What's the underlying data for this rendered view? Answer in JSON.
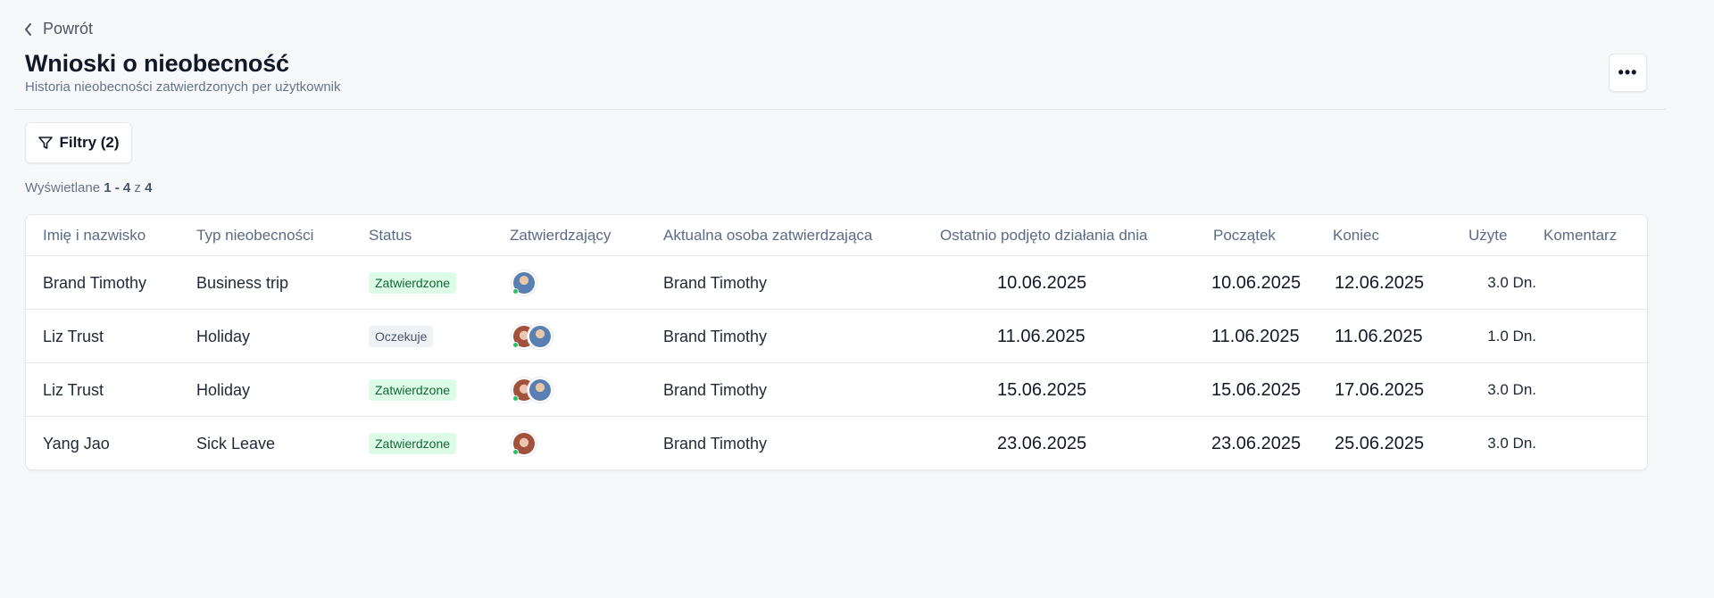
{
  "nav": {
    "back_label": "Powrót"
  },
  "header": {
    "title": "Wnioski o nieobecność",
    "subtitle": "Historia nieobecności zatwierdzonych per użytkownik",
    "more_label": "•••"
  },
  "toolbar": {
    "filter_label": "Filtry (2)"
  },
  "pagination": {
    "prefix": "Wyświetlane",
    "range": "1 - 4",
    "of": "z",
    "total": "4"
  },
  "table": {
    "columns": [
      "Imię i nazwisko",
      "Typ nieobecności",
      "Status",
      "Zatwierdzający",
      "Aktualna osoba zatwierdzająca",
      "Ostatnio podjęto działania dnia",
      "Początek",
      "Koniec",
      "Użyte",
      "Komentarz"
    ],
    "rows": [
      {
        "name": "Brand Timothy",
        "type": "Business trip",
        "status": "Zatwierdzone",
        "status_kind": "approved",
        "approvers": [
          "man-avatar"
        ],
        "current_approver": "Brand Timothy",
        "last_action": "10.06.2025",
        "start": "10.06.2025",
        "end": "12.06.2025",
        "used": "3.0 Dn.",
        "comment": ""
      },
      {
        "name": "Liz Trust",
        "type": "Holiday",
        "status": "Oczekuje",
        "status_kind": "pending",
        "approvers": [
          "woman-avatar",
          "man-avatar"
        ],
        "current_approver": "Brand Timothy",
        "last_action": "11.06.2025",
        "start": "11.06.2025",
        "end": "11.06.2025",
        "used": "1.0 Dn.",
        "comment": ""
      },
      {
        "name": "Liz Trust",
        "type": "Holiday",
        "status": "Zatwierdzone",
        "status_kind": "approved",
        "approvers": [
          "woman-avatar",
          "man-avatar"
        ],
        "current_approver": "Brand Timothy",
        "last_action": "15.06.2025",
        "start": "15.06.2025",
        "end": "17.06.2025",
        "used": "3.0 Dn.",
        "comment": ""
      },
      {
        "name": "Yang Jao",
        "type": "Sick Leave",
        "status": "Zatwierdzone",
        "status_kind": "approved",
        "approvers": [
          "woman-avatar"
        ],
        "current_approver": "Brand Timothy",
        "last_action": "23.06.2025",
        "start": "23.06.2025",
        "end": "25.06.2025",
        "used": "3.0 Dn.",
        "comment": ""
      }
    ]
  },
  "colors": {
    "approved_bg": "#dcfce7",
    "approved_text": "#166534",
    "pending_bg": "#eef2f7",
    "pending_text": "#475569",
    "online_dot": "#22c55e"
  }
}
